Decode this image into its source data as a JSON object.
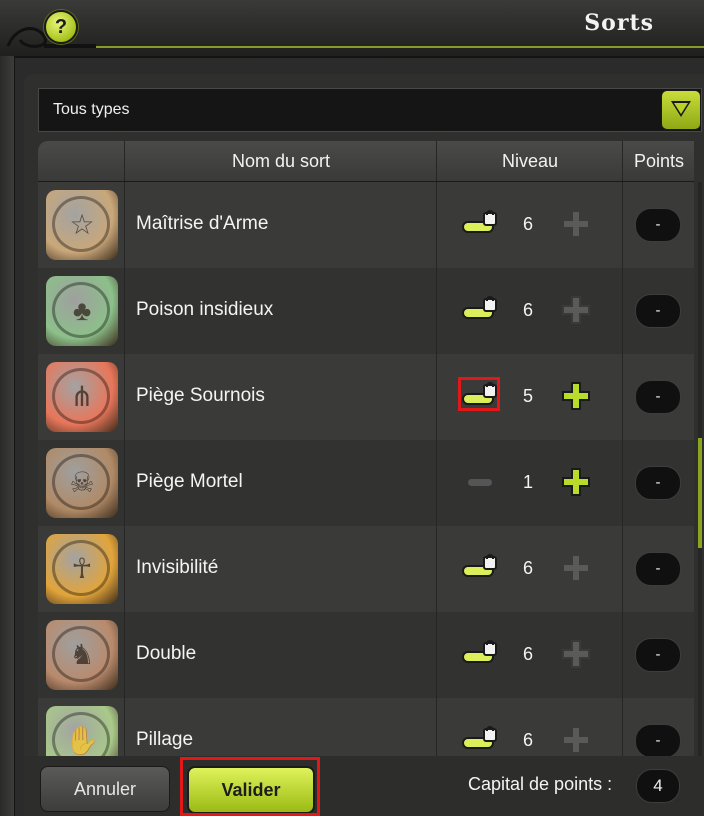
{
  "window": {
    "title": "Sorts",
    "help_label": "?"
  },
  "filter": {
    "selected": "Tous types"
  },
  "table": {
    "headers": {
      "name": "Nom du sort",
      "level": "Niveau",
      "points": "Points"
    },
    "rows": [
      {
        "name": "Maîtrise d'Arme",
        "level": "6",
        "points": "-",
        "icon": "star-medal-icon",
        "icon_color": "#c9a77a",
        "level_state": "locked",
        "plus_enabled": false
      },
      {
        "name": "Poison insidieux",
        "level": "6",
        "points": "-",
        "icon": "poison-plant-icon",
        "icon_color": "#8cc08a",
        "level_state": "locked",
        "plus_enabled": false
      },
      {
        "name": "Piège Sournois",
        "level": "5",
        "points": "-",
        "icon": "spike-trap-icon",
        "icon_color": "#e8765a",
        "level_state": "locked",
        "plus_enabled": true
      },
      {
        "name": "Piège Mortel",
        "level": "1",
        "points": "-",
        "icon": "skull-trap-icon",
        "icon_color": "#b08a66",
        "level_state": "minus",
        "plus_enabled": true
      },
      {
        "name": "Invisibilité",
        "level": "6",
        "points": "-",
        "icon": "invisible-figure-icon",
        "icon_color": "#e2a43a",
        "level_state": "locked",
        "plus_enabled": false
      },
      {
        "name": "Double",
        "level": "6",
        "points": "-",
        "icon": "double-figure-icon",
        "icon_color": "#b98a6c",
        "level_state": "locked",
        "plus_enabled": false
      },
      {
        "name": "Pillage",
        "level": "6",
        "points": "-",
        "icon": "pillage-hand-icon",
        "icon_color": "#a9c98a",
        "level_state": "locked",
        "plus_enabled": false
      }
    ]
  },
  "footer": {
    "cancel_label": "Annuler",
    "validate_label": "Valider",
    "capital_label": "Capital de points :",
    "capital_value": "4"
  },
  "colors": {
    "accent": "#a8c21d",
    "highlight": "#e01818"
  }
}
